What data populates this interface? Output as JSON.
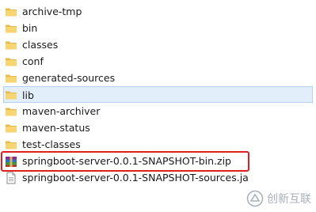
{
  "files": [
    {
      "name": "archive-tmp",
      "icon": "folder-icon",
      "type": "folder"
    },
    {
      "name": "bin",
      "icon": "folder-icon",
      "type": "folder"
    },
    {
      "name": "classes",
      "icon": "folder-icon",
      "type": "folder"
    },
    {
      "name": "conf",
      "icon": "folder-icon",
      "type": "folder"
    },
    {
      "name": "generated-sources",
      "icon": "folder-icon",
      "type": "folder"
    },
    {
      "name": "lib",
      "icon": "folder-icon",
      "type": "folder"
    },
    {
      "name": "maven-archiver",
      "icon": "folder-icon",
      "type": "folder"
    },
    {
      "name": "maven-status",
      "icon": "folder-icon",
      "type": "folder"
    },
    {
      "name": "test-classes",
      "icon": "folder-icon",
      "type": "folder"
    },
    {
      "name": "springboot-server-0.0.1-SNAPSHOT-bin.zip",
      "icon": "zip-archive-icon",
      "type": "zip"
    },
    {
      "name": "springboot-server-0.0.1-SNAPSHOT-sources.ja",
      "icon": "jar-file-icon",
      "type": "jar"
    }
  ],
  "selected_item": "lib",
  "highlighted_item": "springboot-server-0.0.1-SNAPSHOT-bin.zip",
  "highlight_color": "#e02020",
  "watermark": {
    "text": "创新互联",
    "icon": "brand-logo-icon"
  }
}
